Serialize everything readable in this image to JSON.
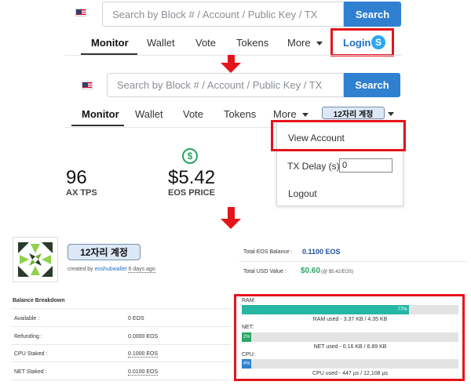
{
  "search": {
    "placeholder": "Search by Block # / Account / Public Key / TX",
    "button": "Search"
  },
  "nav": {
    "items": [
      "Monitor",
      "Wallet",
      "Vote",
      "Tokens",
      "More"
    ],
    "login": "Login"
  },
  "account": {
    "name": "12자리 계정",
    "menu": {
      "view_account": "View Account",
      "tx_delay_label": "TX Delay (s):",
      "tx_delay_value": "0",
      "logout": "Logout"
    },
    "created_prefix": "created by",
    "created_by": "eoshubwallet",
    "created_ago": "6 days ago"
  },
  "stats": {
    "tps_value": "96",
    "tps_label": "AX TPS",
    "price_value": "$5.42",
    "price_label": "EOS PRICE"
  },
  "balance": {
    "title": "Balance Breakdown",
    "rows": [
      {
        "label": "Available :",
        "value": "0 EOS"
      },
      {
        "label": "Refunding :",
        "value": "0.0000 EOS"
      },
      {
        "label": "CPU Staked :",
        "value": "0.1000 EOS"
      },
      {
        "label": "NET Staked :",
        "value": "0.0100 EOS"
      }
    ],
    "total_eos_label": "Total EOS Balance :",
    "total_eos_value": "0.1100 EOS",
    "total_usd_label": "Total USD Value :",
    "total_usd_value": "$0.60",
    "total_usd_note": "(@ $5.42/EOS)"
  },
  "resources": {
    "ram": {
      "label": "RAM:",
      "percent_text": "77%",
      "fill": 0.77,
      "caption": "RAM used - 3.37 KB / 4.35 KB"
    },
    "net": {
      "label": "NET:",
      "percent_text": "2%",
      "fill": 0.02,
      "caption": "NET used - 0.16 KB / 6.89 KB"
    },
    "cpu": {
      "label": "CPU:",
      "percent_text": "4%",
      "fill": 0.04,
      "caption": "CPU used - 447 µs / 12,108 µs"
    }
  },
  "colors": {
    "accent": "#2f80d1",
    "highlight": "#e4141b",
    "ram_bar": "#26b6a4",
    "net_bar": "#27a664",
    "cpu_bar": "#2f80d1"
  }
}
